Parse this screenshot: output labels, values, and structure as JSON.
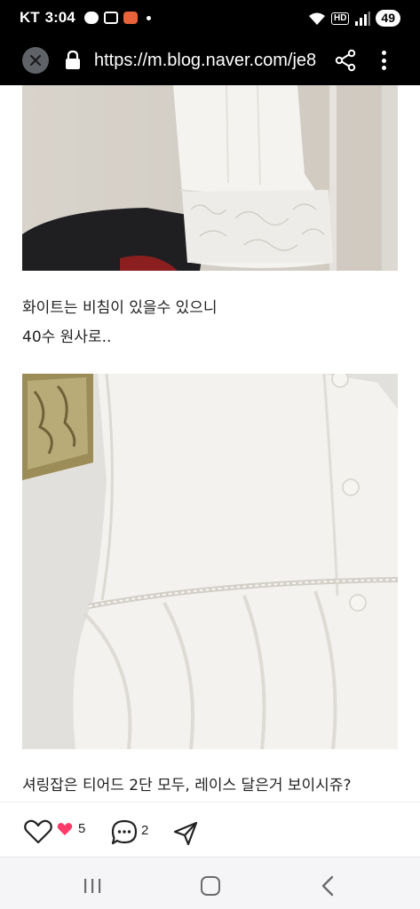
{
  "status_bar": {
    "carrier": "KT",
    "time": "3:04",
    "hd_label": "HD",
    "battery": "49"
  },
  "address_bar": {
    "url": "https://m.blog.naver.com/je8"
  },
  "post": {
    "paragraphs": [
      "화이트는 비침이 있을수 있으니",
      "40수 원사로..",
      "셔링잡은 티어드 2단 모두, 레이스 달은거 보이시쥬?"
    ]
  },
  "reactions": {
    "like_count": "5",
    "comment_count": "2"
  },
  "colors": {
    "background": "#ffffff",
    "top_bars": "#000000",
    "heart": "#ff3b6b",
    "nav_bar": "#f5f5f7"
  },
  "icons": {
    "close": "close-icon",
    "lock": "lock-icon",
    "share": "share-icon",
    "menu": "more-vert-icon",
    "like": "heart-outline-icon",
    "liked": "heart-filled-icon",
    "comment": "comment-icon",
    "send": "send-icon",
    "nav_recent": "recent-apps-icon",
    "nav_home": "home-icon",
    "nav_back": "back-icon"
  }
}
